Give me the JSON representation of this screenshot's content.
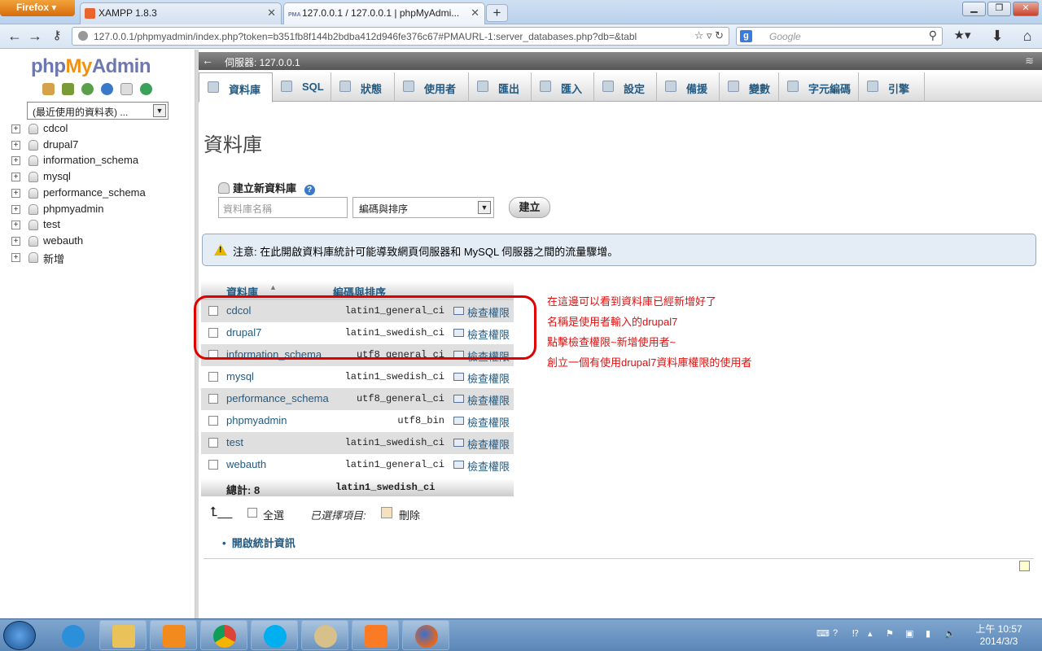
{
  "browser": {
    "firefox_button": "Firefox",
    "tabs": [
      {
        "title": "XAMPP 1.8.3"
      },
      {
        "title": "127.0.0.1 / 127.0.0.1 | phpMyAdmi..."
      }
    ],
    "new_tab": "+",
    "url": "127.0.0.1/phpmyadmin/index.php?token=b351fb8f144b2bdba412d946fe376c67#PMAURL-1:server_databases.php?db=&tabl",
    "search_placeholder": "Google",
    "pma_favicon": "PMA"
  },
  "sidebar": {
    "logo_php": "php",
    "logo_my": "My",
    "logo_admin": "Admin",
    "recent_label": "(最近使用的資料表) ...",
    "databases": [
      "cdcol",
      "drupal7",
      "information_schema",
      "mysql",
      "performance_schema",
      "phpmyadmin",
      "test",
      "webauth",
      "新增"
    ]
  },
  "main": {
    "server_label": "伺服器: 127.0.0.1",
    "menu": [
      "資料庫",
      "SQL",
      "狀態",
      "使用者",
      "匯出",
      "匯入",
      "設定",
      "備援",
      "變數",
      "字元編碼",
      "引擎"
    ],
    "page_title": "資料庫",
    "create_header": "建立新資料庫",
    "db_name_placeholder": "資料庫名稱",
    "collation_select": "編碼與排序",
    "create_button": "建立",
    "notice": "注意: 在此開啟資料庫統計可能導致網頁伺服器和 MySQL 伺服器之間的流量驟增。",
    "notice_mysql": "MySQL",
    "table": {
      "headers": [
        "資料庫",
        "編碼與排序"
      ],
      "rows": [
        {
          "name": "cdcol",
          "collation": "latin1_general_ci"
        },
        {
          "name": "drupal7",
          "collation": "latin1_swedish_ci"
        },
        {
          "name": "information_schema",
          "collation": "utf8_general_ci"
        },
        {
          "name": "mysql",
          "collation": "latin1_swedish_ci"
        },
        {
          "name": "performance_schema",
          "collation": "utf8_general_ci"
        },
        {
          "name": "phpmyadmin",
          "collation": "utf8_bin"
        },
        {
          "name": "test",
          "collation": "latin1_swedish_ci"
        },
        {
          "name": "webauth",
          "collation": "latin1_general_ci"
        }
      ],
      "privileges_label": "檢查權限",
      "total_label": "總計: 8",
      "total_collation": "latin1_swedish_ci"
    },
    "select_all": "全選",
    "with_selected": "已選擇項目:",
    "delete": "刪除",
    "stats_link": "開啟統計資訊"
  },
  "annotation": [
    "在這邊可以看到資料庫已經新增好了",
    "名稱是使用者輸入的drupal7",
    "點擊檢查權限~新增使用者~",
    "創立一個有使用drupal7資料庫權限的使用者"
  ],
  "taskbar": {
    "time": "上午 10:57",
    "date": "2014/3/3"
  },
  "colors": {
    "link": "#235a81",
    "annotation_red": "#e01010",
    "logo_orange": "#f29111",
    "logo_blue": "#6c78af"
  }
}
